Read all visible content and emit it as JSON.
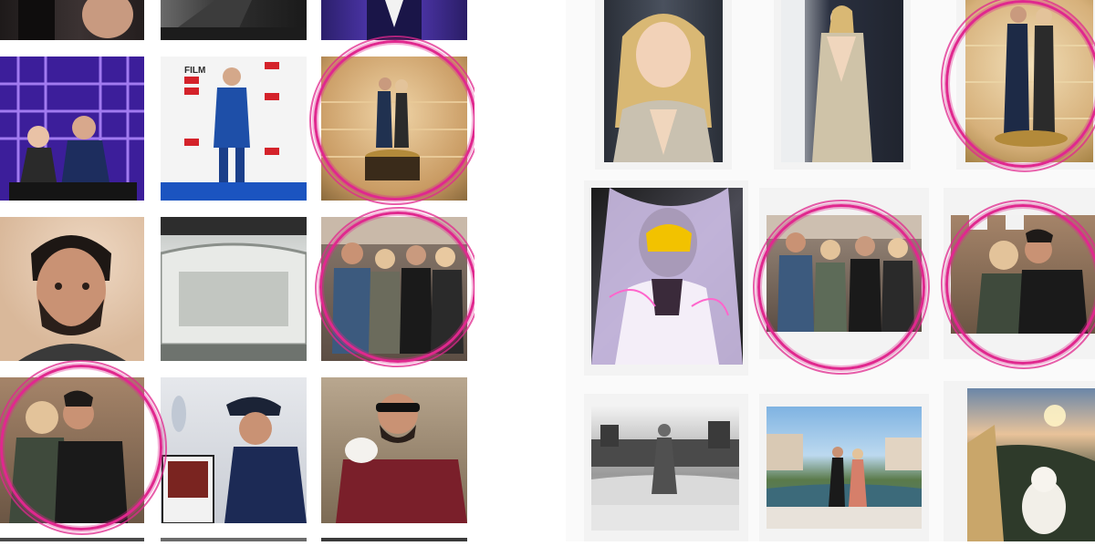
{
  "highlight_color": "#e0288e",
  "left_grid": {
    "tiles": [
      {
        "id": "l-r0c0",
        "subject": "red-carpet-dark"
      },
      {
        "id": "l-r0c1",
        "subject": "suit-closeup"
      },
      {
        "id": "l-r0c2",
        "subject": "purple-suit"
      },
      {
        "id": "l-r1c0",
        "subject": "awards-podium-couple"
      },
      {
        "id": "l-r1c1",
        "subject": "film-awards-backdrop",
        "text": "FILM"
      },
      {
        "id": "l-r1c2",
        "subject": "couple-on-pedestal",
        "circled": true
      },
      {
        "id": "l-r2c0",
        "subject": "bearded-portrait"
      },
      {
        "id": "l-r2c1",
        "subject": "car-window"
      },
      {
        "id": "l-r2c2",
        "subject": "group-selfie",
        "circled": true
      },
      {
        "id": "l-r3c0",
        "subject": "couple-kiss",
        "circled": true
      },
      {
        "id": "l-r3c1",
        "subject": "airplane-magazine"
      },
      {
        "id": "l-r3c2",
        "subject": "coffee-sunglasses"
      }
    ]
  },
  "right_grid": {
    "tiles": [
      {
        "id": "r-r0c0",
        "subject": "blonde-gown-portrait"
      },
      {
        "id": "r-r0c1",
        "subject": "sequin-gown-full"
      },
      {
        "id": "r-r0c2",
        "subject": "couple-on-pedestal",
        "circled": true
      },
      {
        "id": "r-r1c0",
        "subject": "neon-filter-selfie"
      },
      {
        "id": "r-r1c1",
        "subject": "group-selfie",
        "circled": true
      },
      {
        "id": "r-r1c2",
        "subject": "couple-kiss",
        "circled": true
      },
      {
        "id": "r-r2c0",
        "subject": "bw-canal-street"
      },
      {
        "id": "r-r2c1",
        "subject": "venice-canal-pair"
      },
      {
        "id": "r-r2c2",
        "subject": "sunset-with-dog"
      }
    ]
  }
}
